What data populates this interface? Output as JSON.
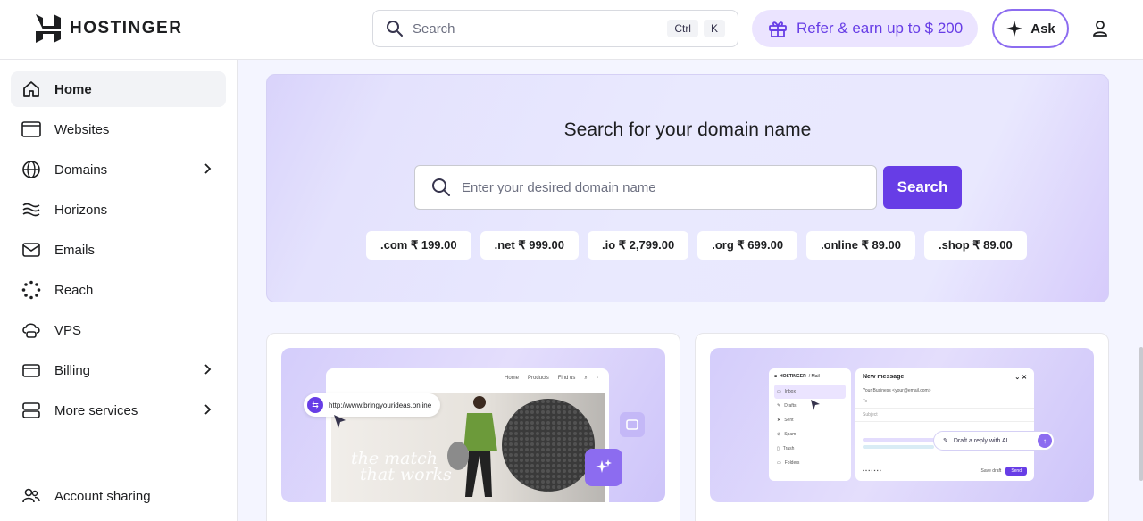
{
  "header": {
    "logo_text": "HOSTINGER",
    "search_placeholder": "Search",
    "shortcut_keys": [
      "Ctrl",
      "K"
    ],
    "refer_label": "Refer & earn up to $ 200",
    "ask_label": "Ask"
  },
  "sidebar": {
    "items": [
      {
        "label": "Home",
        "icon": "home-icon",
        "active": true
      },
      {
        "label": "Websites",
        "icon": "browser-window-icon"
      },
      {
        "label": "Domains",
        "icon": "globe-icon",
        "has_submenu": true
      },
      {
        "label": "Horizons",
        "icon": "waves-icon"
      },
      {
        "label": "Emails",
        "icon": "mail-icon"
      },
      {
        "label": "Reach",
        "icon": "dotted-circle-icon"
      },
      {
        "label": "VPS",
        "icon": "cloud-server-icon"
      },
      {
        "label": "Billing",
        "icon": "credit-card-icon",
        "has_submenu": true
      },
      {
        "label": "More services",
        "icon": "stack-icon",
        "has_submenu": true
      },
      {
        "label": "Account sharing",
        "icon": "users-icon"
      }
    ]
  },
  "domain_search": {
    "title": "Search for your domain name",
    "placeholder": "Enter your desired domain name",
    "button_label": "Search",
    "tlds": [
      ".com ₹ 199.00",
      ".net ₹ 999.00",
      ".io ₹ 2,799.00",
      ".org ₹ 699.00",
      ".online ₹ 89.00",
      ".shop ₹ 89.00"
    ]
  },
  "promo_website": {
    "url_text": "http://www.bringyourideas.online",
    "nav": [
      "Home",
      "Products",
      "Find us"
    ],
    "tagline_1": "the match",
    "tagline_2": "that works"
  },
  "promo_mail": {
    "brand": "HOSTINGER",
    "brand_suffix": "/ Mail",
    "folders": [
      "Inbox",
      "Drafts",
      "Sent",
      "Spam",
      "Trash",
      "Folders"
    ],
    "compose_title": "New message",
    "from_text": "Your Business <your@email.com>",
    "to_label": "To",
    "subject_label": "Subject",
    "ai_pill": "Draft a reply with AI",
    "draft_label": "Save draft",
    "send_label": "Send"
  },
  "colors": {
    "accent": "#673de6",
    "accent_light": "#ebe4ff",
    "text": "#1d1e20"
  }
}
